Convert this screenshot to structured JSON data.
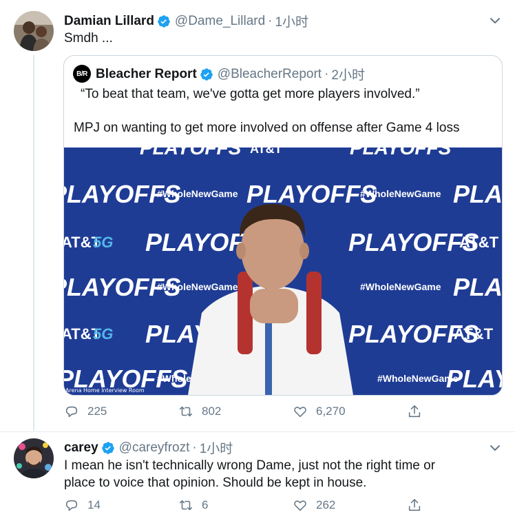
{
  "tweet1": {
    "name": "Damian Lillard",
    "handle": "@Dame_Lillard",
    "dot": "·",
    "time": "1小时",
    "text": "Smdh ...",
    "reply_count": "225",
    "retweet_count": "802",
    "like_count": "6,270"
  },
  "quote": {
    "logo": "B/R",
    "name": "Bleacher Report",
    "handle": "@BleacherReport",
    "dot": "·",
    "time": "2小时",
    "line1": "“To beat that team, we've gotta get more players involved.”",
    "line2": "MPJ on wanting to get more involved on offense after Game 4 loss",
    "video_overlay_label": "Arena Home Interview Room",
    "backdrop": {
      "playoffs": "PLAYOFFS",
      "hashtag": "#WholeNewGame",
      "att": "AT&T",
      "fiveg": "5G"
    }
  },
  "tweet2": {
    "name": "carey",
    "handle": "@careyfrozt",
    "dot": "·",
    "time": "1小时",
    "text_line1": "I mean he isn't technically wrong Dame, just not the right time or",
    "text_line2": "place to voice that opinion. Should be kept in house.",
    "reply_count": "14",
    "retweet_count": "6",
    "like_count": "262"
  },
  "colors": {
    "verified": "#1da1f2",
    "muted": "#657786",
    "backdrop_blue": "#1f3c95",
    "border": "#ccd6dd"
  },
  "icons": [
    "reply-icon",
    "retweet-icon",
    "like-icon",
    "share-icon",
    "verified-badge-icon",
    "chevron-down-icon"
  ]
}
